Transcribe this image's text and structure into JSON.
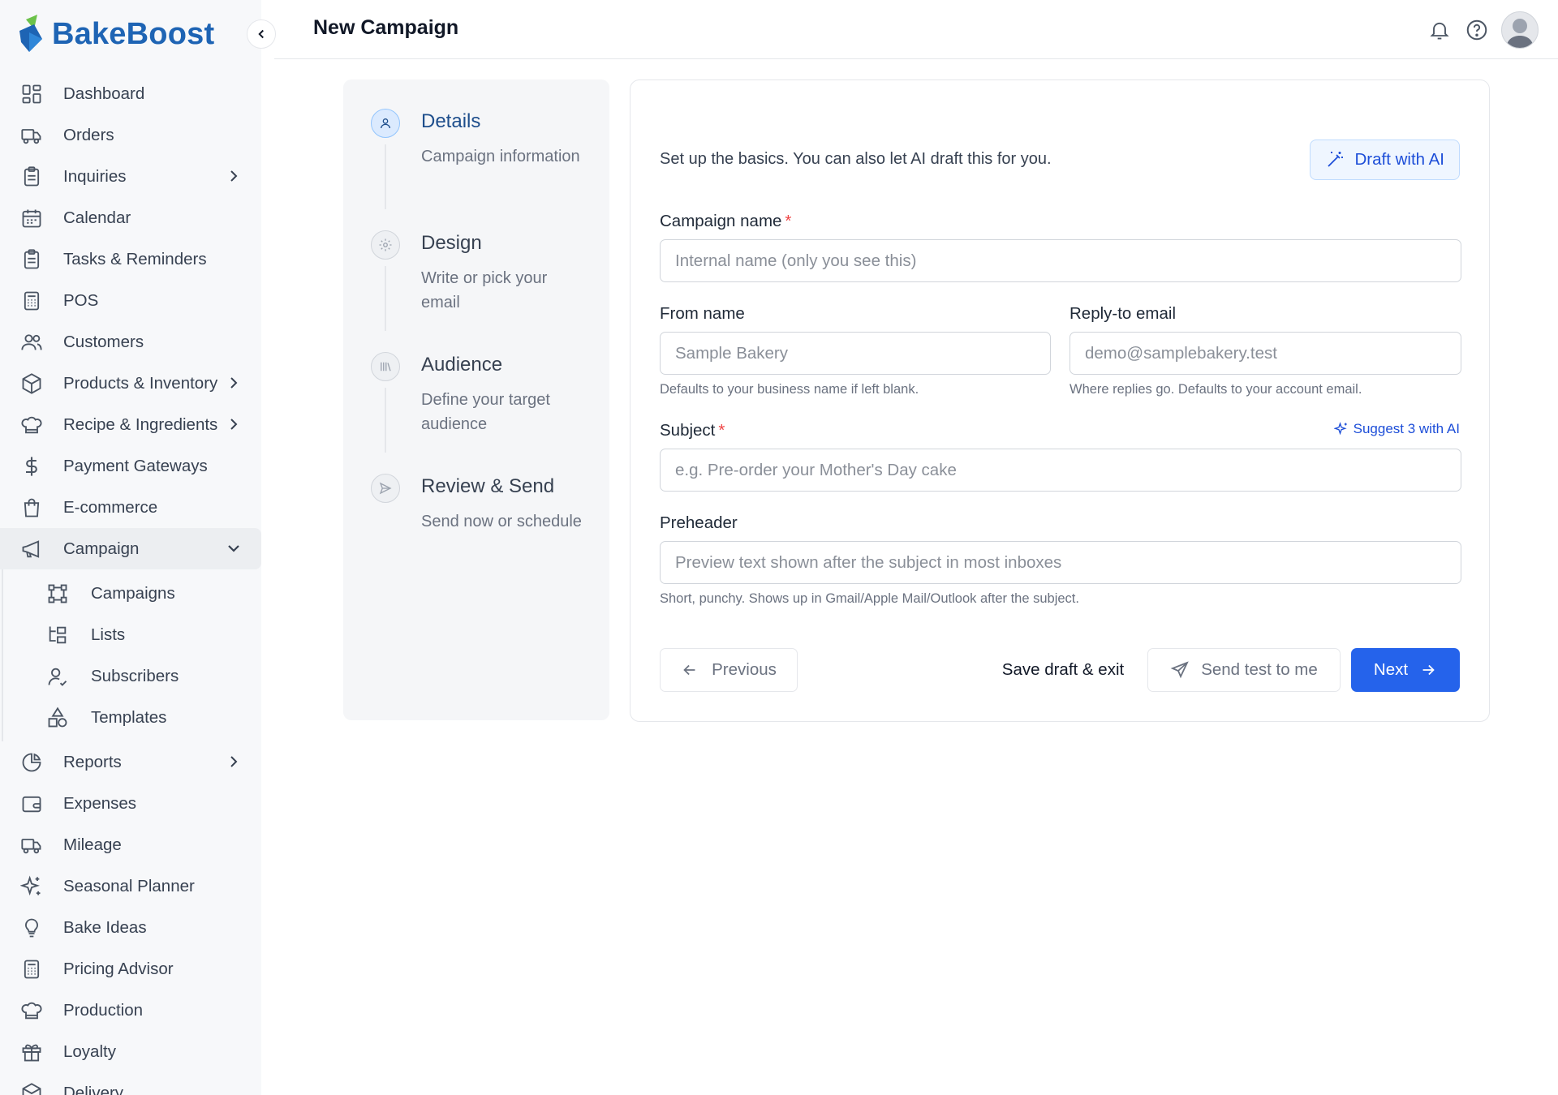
{
  "app": {
    "brand": "BakeBoost"
  },
  "header": {
    "title": "New Campaign"
  },
  "sidebar": {
    "items": [
      {
        "label": "Dashboard"
      },
      {
        "label": "Orders"
      },
      {
        "label": "Inquiries"
      },
      {
        "label": "Calendar"
      },
      {
        "label": "Tasks & Reminders"
      },
      {
        "label": "POS"
      },
      {
        "label": "Customers"
      },
      {
        "label": "Products & Inventory"
      },
      {
        "label": "Recipe & Ingredients"
      },
      {
        "label": "Payment Gateways"
      },
      {
        "label": "E-commerce"
      },
      {
        "label": "Campaign"
      }
    ],
    "campaign_sub": [
      {
        "label": "Campaigns"
      },
      {
        "label": "Lists"
      },
      {
        "label": "Subscribers"
      },
      {
        "label": "Templates"
      }
    ],
    "items_after": [
      {
        "label": "Reports"
      },
      {
        "label": "Expenses"
      },
      {
        "label": "Mileage"
      },
      {
        "label": "Seasonal Planner"
      },
      {
        "label": "Bake Ideas"
      },
      {
        "label": "Pricing Advisor"
      },
      {
        "label": "Production"
      },
      {
        "label": "Loyalty"
      },
      {
        "label": "Delivery"
      }
    ]
  },
  "stepper": {
    "steps": [
      {
        "title": "Details",
        "desc": "Campaign information"
      },
      {
        "title": "Design",
        "desc": "Write or pick your email"
      },
      {
        "title": "Audience",
        "desc": "Define your target audience"
      },
      {
        "title": "Review & Send",
        "desc": "Send now or schedule"
      }
    ]
  },
  "form": {
    "intro": "Set up the basics. You can also let AI draft this for you.",
    "draft_ai": "Draft with AI",
    "campaign_name": {
      "label": "Campaign name",
      "placeholder": "Internal name (only you see this)",
      "value": ""
    },
    "from_name": {
      "label": "From name",
      "placeholder": "Sample Bakery",
      "value": "",
      "hint": "Defaults to your business name if left blank."
    },
    "reply_to": {
      "label": "Reply-to email",
      "placeholder": "demo@samplebakery.test",
      "value": "",
      "hint": "Where replies go. Defaults to your account email."
    },
    "subject": {
      "label": "Subject",
      "placeholder": "e.g. Pre-order your Mother's Day cake",
      "value": "",
      "suggest": "Suggest 3 with AI"
    },
    "preheader": {
      "label": "Preheader",
      "placeholder": "Preview text shown after the subject in most inboxes",
      "value": "",
      "hint": "Short, punchy. Shows up in Gmail/Apple Mail/Outlook after the subject."
    },
    "required_mark": "*"
  },
  "actions": {
    "previous": "Previous",
    "save_exit": "Save draft & exit",
    "send_test": "Send test to me",
    "next": "Next"
  },
  "colors": {
    "brand": "#1e64b4",
    "primary": "#2563eb",
    "required": "#ef4444"
  }
}
